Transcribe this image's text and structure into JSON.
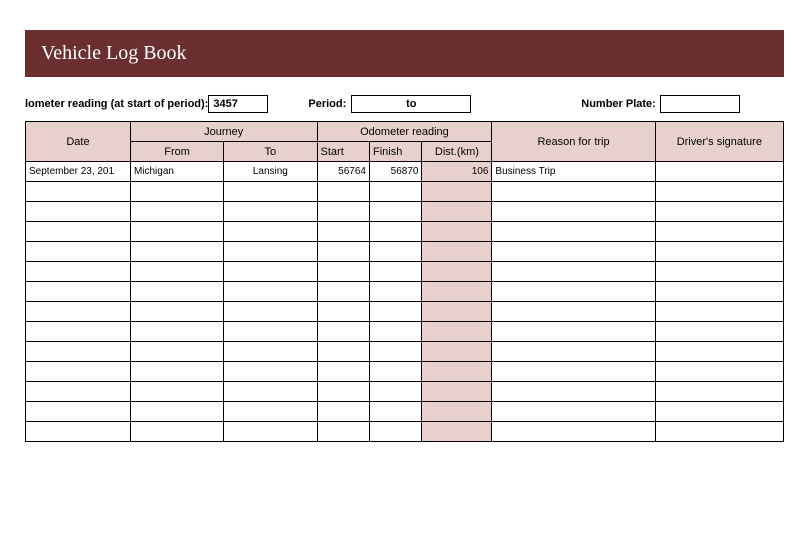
{
  "title": "Vehicle Log Book",
  "meta": {
    "odometer_label": "lometer reading (at start of period):",
    "odometer_value": "3457",
    "period_label": "Period:",
    "period_value": "to",
    "plate_label": "Number Plate:",
    "plate_value": ""
  },
  "headers": {
    "date": "Date",
    "journey": "Journey",
    "from": "From",
    "to": "To",
    "odometer": "Odometer reading",
    "start": "Start",
    "finish": "Finish",
    "dist": "Dist.(km)",
    "reason": "Reason for trip",
    "signature": "Driver's signature"
  },
  "rows": [
    {
      "date": "September 23, 201",
      "from": "Michigan",
      "to": "Lansing",
      "start": "56764",
      "finish": "56870",
      "dist": "106",
      "reason": "Business Trip",
      "signature": ""
    },
    {
      "date": "",
      "from": "",
      "to": "",
      "start": "",
      "finish": "",
      "dist": "",
      "reason": "",
      "signature": ""
    },
    {
      "date": "",
      "from": "",
      "to": "",
      "start": "",
      "finish": "",
      "dist": "",
      "reason": "",
      "signature": ""
    },
    {
      "date": "",
      "from": "",
      "to": "",
      "start": "",
      "finish": "",
      "dist": "",
      "reason": "",
      "signature": ""
    },
    {
      "date": "",
      "from": "",
      "to": "",
      "start": "",
      "finish": "",
      "dist": "",
      "reason": "",
      "signature": ""
    },
    {
      "date": "",
      "from": "",
      "to": "",
      "start": "",
      "finish": "",
      "dist": "",
      "reason": "",
      "signature": ""
    },
    {
      "date": "",
      "from": "",
      "to": "",
      "start": "",
      "finish": "",
      "dist": "",
      "reason": "",
      "signature": ""
    },
    {
      "date": "",
      "from": "",
      "to": "",
      "start": "",
      "finish": "",
      "dist": "",
      "reason": "",
      "signature": ""
    },
    {
      "date": "",
      "from": "",
      "to": "",
      "start": "",
      "finish": "",
      "dist": "",
      "reason": "",
      "signature": ""
    },
    {
      "date": "",
      "from": "",
      "to": "",
      "start": "",
      "finish": "",
      "dist": "",
      "reason": "",
      "signature": ""
    },
    {
      "date": "",
      "from": "",
      "to": "",
      "start": "",
      "finish": "",
      "dist": "",
      "reason": "",
      "signature": ""
    },
    {
      "date": "",
      "from": "",
      "to": "",
      "start": "",
      "finish": "",
      "dist": "",
      "reason": "",
      "signature": ""
    },
    {
      "date": "",
      "from": "",
      "to": "",
      "start": "",
      "finish": "",
      "dist": "",
      "reason": "",
      "signature": ""
    },
    {
      "date": "",
      "from": "",
      "to": "",
      "start": "",
      "finish": "",
      "dist": "",
      "reason": "",
      "signature": ""
    }
  ]
}
